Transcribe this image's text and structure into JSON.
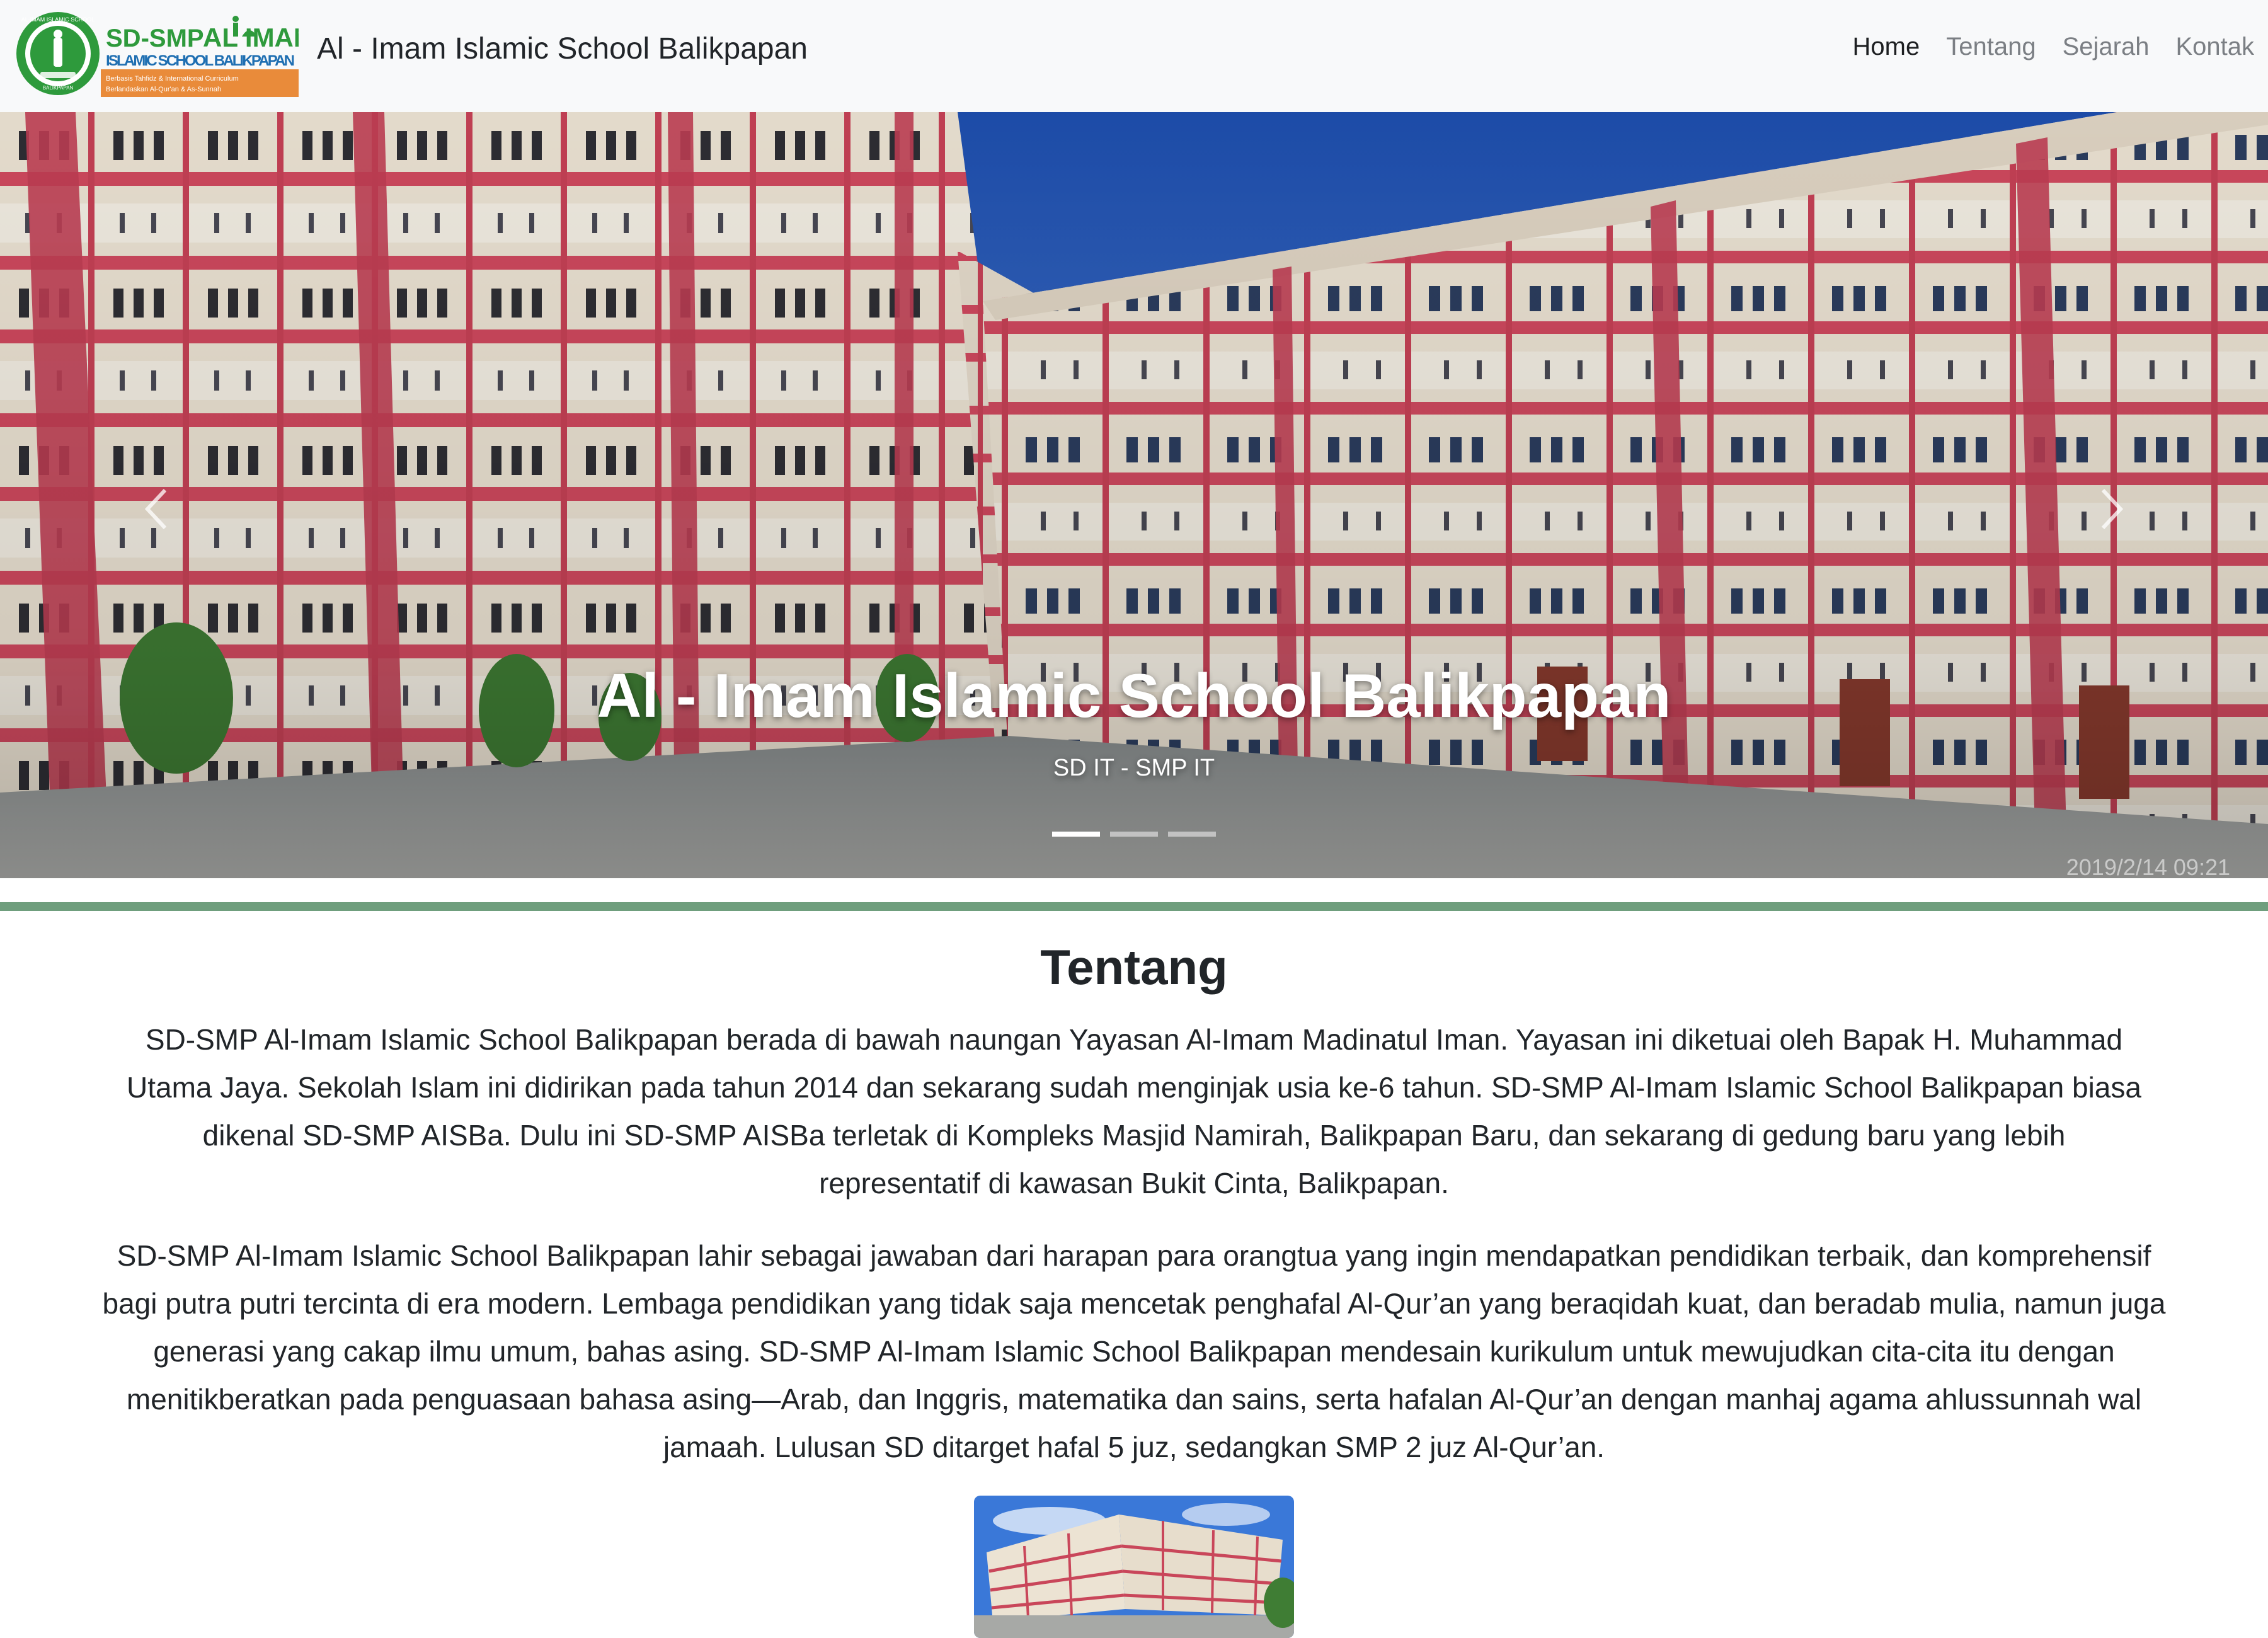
{
  "navbar": {
    "logo": {
      "line1_prefix": "SD-SMP",
      "line1_name": "AL IMAM",
      "line2": "ISLAMIC SCHOOL BALIKPAPAN",
      "tagline1": "Berbasis Tahfidz & International Curriculum",
      "tagline2": "Berlandaskan Al-Qur'an & As-Sunnah",
      "seal_top": "AL-IMAM ISLAMIC SCHOOL",
      "seal_bottom": "BALIKPAPAN",
      "colors": {
        "green": "#2e9a3c",
        "orange": "#e98b3a",
        "blue": "#1f6fb2"
      }
    },
    "brand_title": "Al - Imam Islamic School Balikpapan",
    "links": [
      {
        "label": "Home",
        "active": true
      },
      {
        "label": "Tentang",
        "active": false
      },
      {
        "label": "Sejarah",
        "active": false
      },
      {
        "label": "Kontak",
        "active": false
      }
    ]
  },
  "carousel": {
    "caption_title": "Al - Imam Islamic School Balikpapan",
    "caption_subtitle": "SD IT - SMP IT",
    "slide_count": 3,
    "active_slide": 1,
    "prev_icon": "chevron-left-icon",
    "next_icon": "chevron-right-icon",
    "timestamp": "2019/2/14 09:21"
  },
  "about": {
    "heading": "Tentang",
    "paragraph1": "SD-SMP Al-Imam Islamic School Balikpapan berada di bawah naungan Yayasan Al-Imam Madinatul Iman. Yayasan ini diketuai oleh Bapak H. Muhammad Utama Jaya. Sekolah Islam ini didirikan pada tahun 2014 dan sekarang sudah menginjak usia ke-6 tahun. SD-SMP Al-Imam Islamic School Balikpapan biasa dikenal SD-SMP AISBa. Dulu ini SD-SMP AISBa terletak di Kompleks Masjid Namirah, Balikpapan Baru, dan sekarang di gedung baru yang lebih representatif di kawasan Bukit Cinta, Balikpapan.",
    "paragraph2": "SD-SMP Al-Imam Islamic School Balikpapan lahir sebagai jawaban dari harapan para orangtua yang ingin mendapatkan pendidikan terbaik, dan komprehensif bagi putra putri tercinta di era modern. Lembaga pendidikan yang tidak saja mencetak penghafal Al-Qur’an yang beraqidah kuat, dan beradab mulia, namun juga generasi yang cakap ilmu umum, bahas asing. SD-SMP Al-Imam Islamic School Balikpapan mendesain kurikulum untuk mewujudkan cita-cita itu dengan menitikberatkan pada penguasaan bahasa asing—Arab, dan Inggris, matematika dan sains, serta hafalan Al-Qur’an dengan manhaj agama ahlussunnah wal jamaah. Lulusan SD ditarget hafal 5 juz, sedangkan SMP 2 juz Al-Qur’an."
  },
  "colors": {
    "navbar_bg": "#f8f9fa",
    "separator": "#6f9e7d",
    "building_frame": "#c9465a",
    "building_wall": "#ece3d3",
    "sky": "#2c63c6"
  }
}
